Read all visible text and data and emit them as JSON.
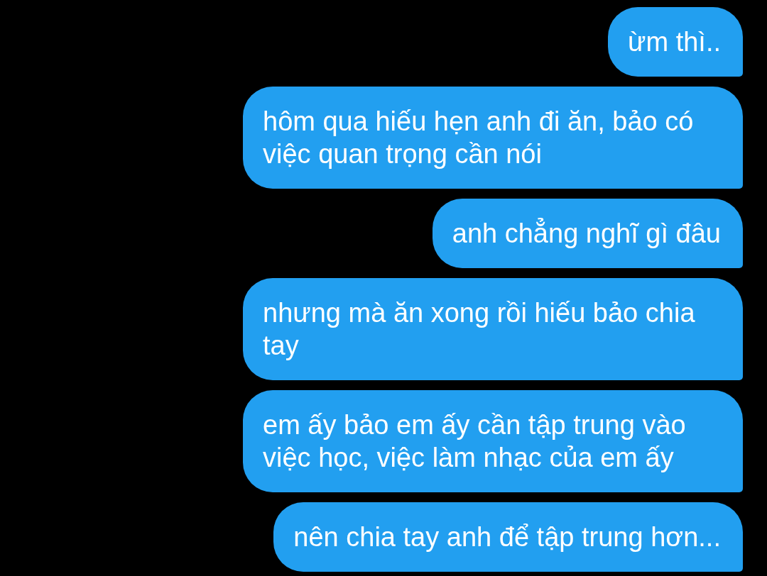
{
  "messages": [
    {
      "text": "ừm thì.."
    },
    {
      "text": "hôm qua hiếu hẹn anh đi ăn, bảo có việc quan trọng cần nói"
    },
    {
      "text": "anh chẳng nghĩ gì đâu"
    },
    {
      "text": "nhưng mà ăn xong rồi hiếu bảo chia tay"
    },
    {
      "text": "em ấy bảo em ấy cần tập trung vào việc học, việc làm nhạc của em ấy"
    },
    {
      "text": "nên chia tay anh để tập trung hơn..."
    }
  ]
}
